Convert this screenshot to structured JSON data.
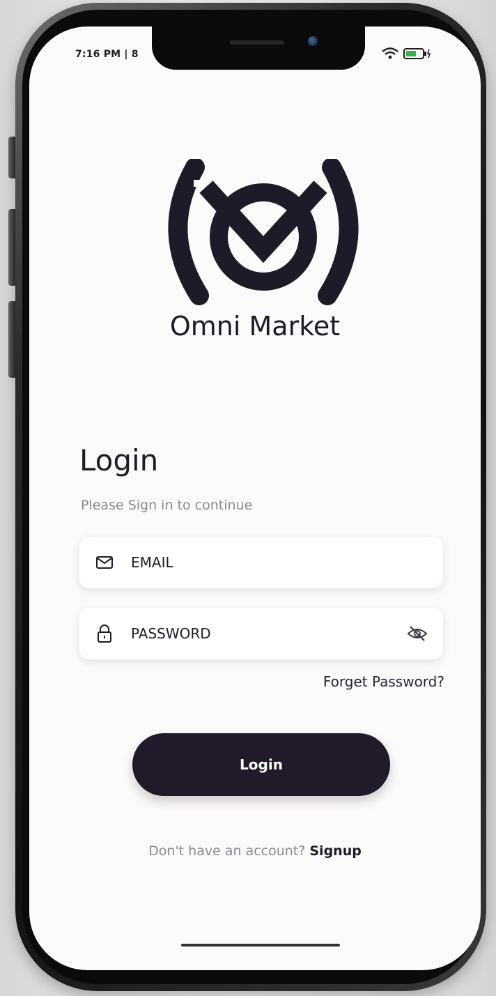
{
  "status_bar": {
    "time": "7:16 PM | 8"
  },
  "brand": {
    "name": "Omni Market",
    "logo_icon": "omni-market-logo",
    "color": "#1f1a28"
  },
  "login": {
    "title": "Login",
    "subtitle": "Please Sign in to continue",
    "email_placeholder": "EMAIL",
    "password_placeholder": "PASSWORD",
    "forget_password": "Forget Password?",
    "button_label": "Login",
    "no_account_text": "Don't have an account?",
    "signup_link": "Signup"
  },
  "icons": {
    "email": "mail-icon",
    "password": "lock-icon",
    "visibility": "eye-off-icon",
    "wifi": "wifi-icon",
    "battery": "battery-icon"
  },
  "colors": {
    "background": "#fdfafc",
    "button": "#201a2b",
    "muted_text": "#8b8790"
  }
}
